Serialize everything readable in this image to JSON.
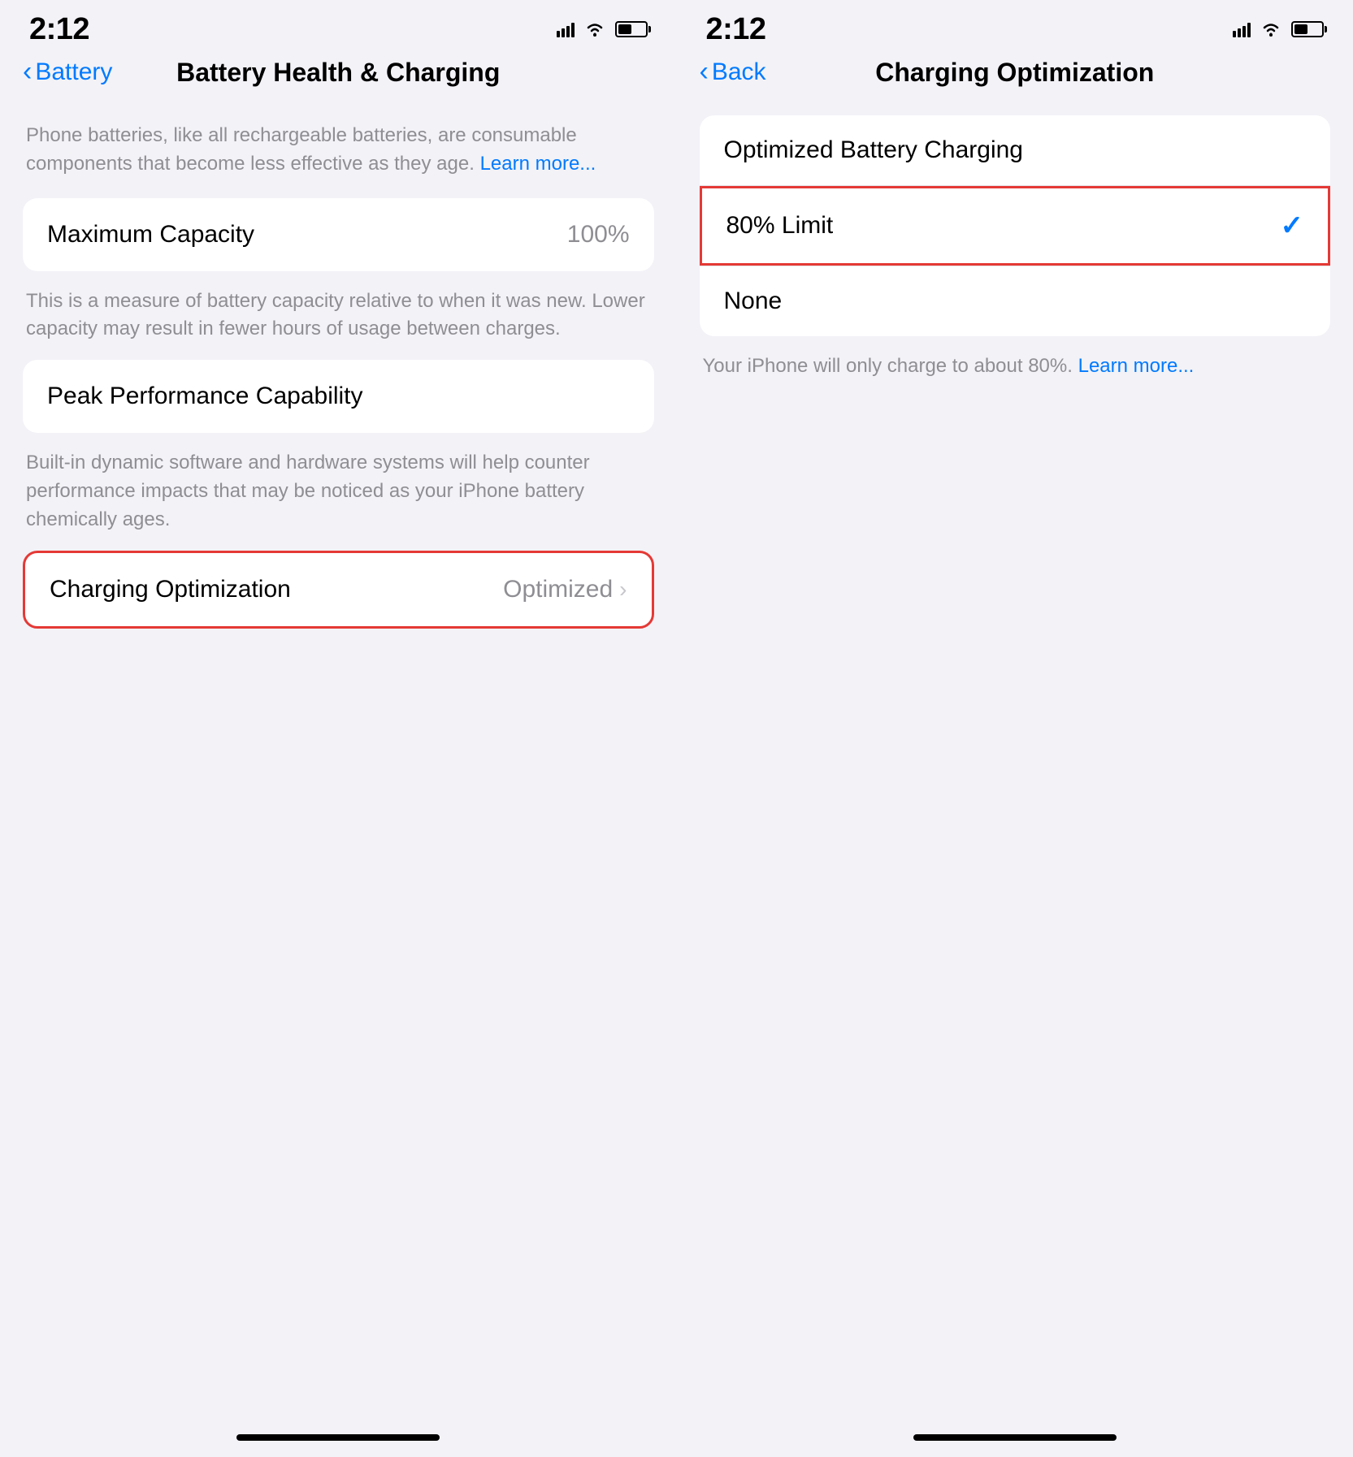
{
  "left_screen": {
    "time": "2:12",
    "nav": {
      "back_label": "Battery",
      "title": "Battery Health & Charging"
    },
    "intro": {
      "text": "Phone batteries, like all rechargeable batteries, are consumable components that become less effective as they age.",
      "learn_more": "Learn more..."
    },
    "maximum_capacity": {
      "label": "Maximum Capacity",
      "value": "100%",
      "description": "This is a measure of battery capacity relative to when it was new. Lower capacity may result in fewer hours of usage between charges."
    },
    "peak_performance": {
      "label": "Peak Performance Capability",
      "description": "Built-in dynamic software and hardware systems will help counter performance impacts that may be noticed as your iPhone battery chemically ages."
    },
    "charging_optimization": {
      "label": "Charging Optimization",
      "value": "Optimized"
    }
  },
  "right_screen": {
    "time": "2:12",
    "nav": {
      "back_label": "Back",
      "title": "Charging Optimization"
    },
    "options": {
      "optimized_label": "Optimized Battery Charging",
      "limit_label": "80% Limit",
      "none_label": "None"
    },
    "footer": {
      "text": "Your iPhone will only charge to about 80%.",
      "learn_more": "Learn more..."
    }
  },
  "icons": {
    "signal": "signal-icon",
    "wifi": "wifi-icon",
    "battery": "battery-status-icon",
    "back_chevron": "‹",
    "chevron_right": "›",
    "checkmark": "✓"
  },
  "colors": {
    "blue": "#007aff",
    "red_border": "#e53935",
    "gray_text": "#8e8e93",
    "black": "#000000",
    "white": "#ffffff",
    "bg": "#f2f2f7"
  }
}
